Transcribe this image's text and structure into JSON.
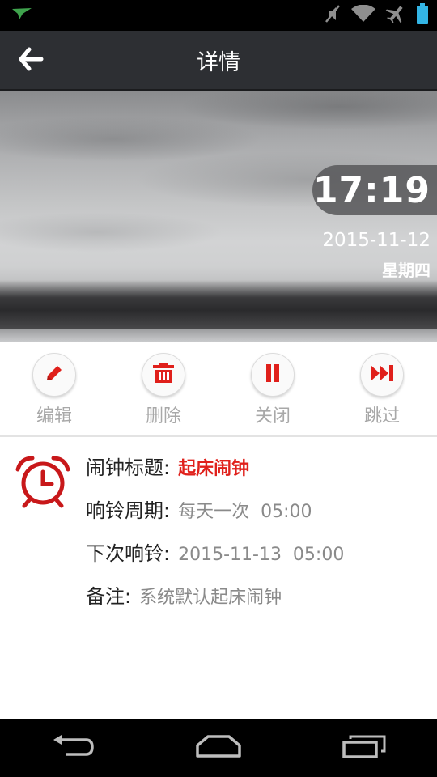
{
  "status_bar": {
    "icons": [
      "app-notification-icon",
      "mute-icon",
      "wifi-icon",
      "airplane-mode-icon",
      "battery-icon"
    ]
  },
  "app_bar": {
    "title": "详情",
    "back_icon": "back-arrow-icon"
  },
  "hero": {
    "time": "17:19",
    "date": "2015-11-12",
    "weekday": "星期四"
  },
  "actions": [
    {
      "label": "编辑",
      "icon": "pencil-icon"
    },
    {
      "label": "删除",
      "icon": "trash-icon"
    },
    {
      "label": "关闭",
      "icon": "pause-icon"
    },
    {
      "label": "跳过",
      "icon": "skip-icon"
    }
  ],
  "details": {
    "icon": "alarm-clock-icon",
    "title_label": "闹钟标题:",
    "title_value": "起床闹钟",
    "cycle_label": "响铃周期:",
    "cycle_value": "每天一次  05:00",
    "next_label": "下次响铃:",
    "next_value": "2015-11-13  05:00",
    "note_label": "备注:",
    "note_value": "系统默认起床闹钟"
  },
  "nav_bar": {
    "icons": [
      "nav-back-icon",
      "nav-home-icon",
      "nav-recents-icon"
    ]
  },
  "colors": {
    "accent_red": "#e0201b",
    "app_bar": "#2d2f33",
    "label_gray": "#a8a8a8"
  }
}
